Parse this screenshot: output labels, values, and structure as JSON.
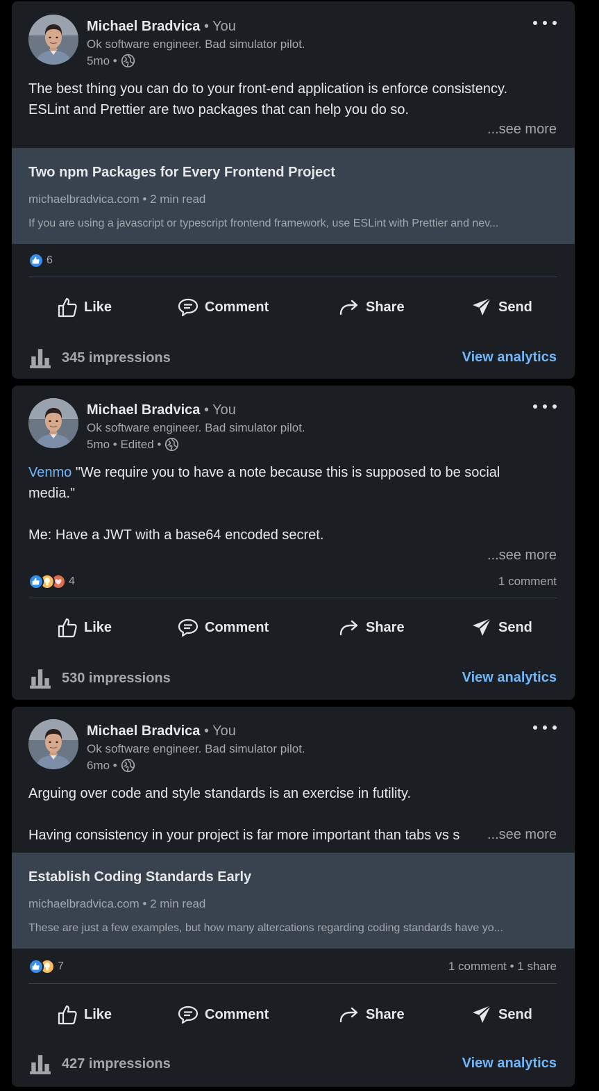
{
  "colors": {
    "background": "#000000",
    "card": "#1b1f23",
    "link_preview": "#38434f",
    "muted_text": "#a3a7ac",
    "accent_link": "#71b7fb",
    "like_blue": "#378fe9",
    "insightful_yellow": "#f5bb5c",
    "love_pink": "#df704d"
  },
  "actions": {
    "like": "Like",
    "comment": "Comment",
    "share": "Share",
    "send": "Send"
  },
  "posts": [
    {
      "author": "Michael Bradvica",
      "you_badge": "• You",
      "headline": "Ok software engineer. Bad simulator pilot.",
      "time": "5mo •",
      "body_lines": [
        "The best thing you can do to your front-end application is enforce consistency.",
        "ESLint and Prettier are two packages that can help you do so."
      ],
      "see_more": "...see more",
      "link": {
        "title": "Two npm Packages for Every Frontend Project",
        "source": "michaelbradvica.com • 2 min read",
        "description": "If you are using a javascript or typescript frontend framework, use ESLint with Prettier and nev..."
      },
      "reaction_icons": [
        "like-icon"
      ],
      "reaction_count": "6",
      "impressions": "345 impressions",
      "view_analytics": "View analytics"
    },
    {
      "author": "Michael Bradvica",
      "you_badge": "• You",
      "headline": "Ok software engineer. Bad simulator pilot.",
      "time": "5mo • Edited •",
      "mention": "Venmo",
      "body_lines": [
        " \"We require you to have a note because this is supposed to be social",
        "media.\"",
        "Me: Have a JWT with a base64 encoded secret."
      ],
      "see_more": "...see more",
      "reaction_icons": [
        "like-icon",
        "insightful-icon",
        "love-icon"
      ],
      "reaction_count": "4",
      "stats": "1 comment",
      "impressions": "530 impressions",
      "view_analytics": "View analytics"
    },
    {
      "author": "Michael Bradvica",
      "you_badge": "• You",
      "headline": "Ok software engineer. Bad simulator pilot.",
      "time": "6mo •",
      "body_lines": [
        "Arguing over code and style standards is an exercise in futility.",
        "Having consistency in your project is far more important than tabs vs s"
      ],
      "see_more": "...see more",
      "link": {
        "title": "Establish Coding Standards Early",
        "source": "michaelbradvica.com • 2 min read",
        "description": "These are just a few examples, but how many altercations regarding coding standards have yo..."
      },
      "reaction_icons": [
        "like-icon",
        "insightful-icon"
      ],
      "reaction_count": "7",
      "stats": "1 comment • 1 share",
      "impressions": "427 impressions",
      "view_analytics": "View analytics"
    }
  ]
}
